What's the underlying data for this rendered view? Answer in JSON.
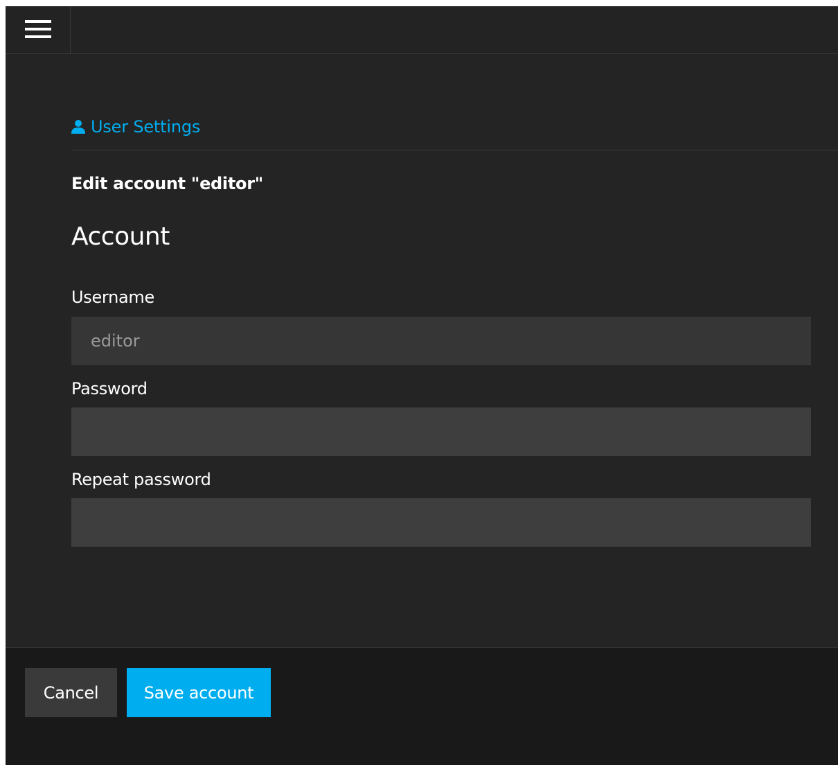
{
  "topbar": {
    "menu_icon": "hamburger-menu-icon"
  },
  "section": {
    "icon": "user-icon",
    "title": "User Settings"
  },
  "page_title": "Edit account \"editor\"",
  "form": {
    "heading": "Account",
    "username": {
      "label": "Username",
      "value": "editor",
      "readonly": true
    },
    "password": {
      "label": "Password",
      "value": ""
    },
    "repeat_password": {
      "label": "Repeat password",
      "value": ""
    }
  },
  "footer": {
    "cancel_label": "Cancel",
    "save_label": "Save account"
  },
  "colors": {
    "accent": "#00aeef",
    "background": "#242424",
    "footer_background": "#191919",
    "input_readonly": "#363636",
    "input_editable": "#3e3e3e",
    "cancel_button": "#3a3a3a"
  }
}
